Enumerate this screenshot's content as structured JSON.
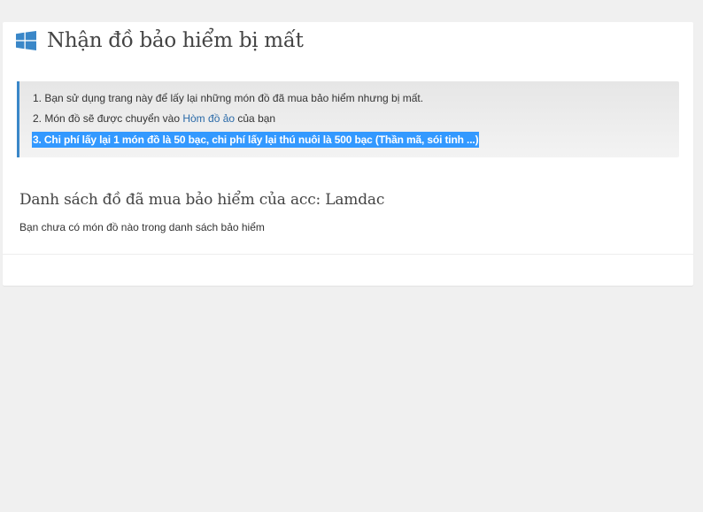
{
  "header": {
    "icon": "windows-logo-icon",
    "title": "Nhận đồ bảo hiểm bị mất"
  },
  "notice": {
    "line1": "1. Bạn sử dụng trang này để lấy lại những món đồ đã mua bảo hiểm nhưng bị mất.",
    "line2_prefix": "2. Món đồ sẽ được chuyển vào ",
    "line2_link": "Hòm đồ ảo",
    "line2_suffix": " của bạn",
    "line3": "3. Chi phí lấy lại 1 món đồ là 50 bạc, chi phí lấy lại thú nuôi là 500 bạc (Thần mã, sói tinh ...)"
  },
  "insured_list": {
    "title": "Danh sách đồ đã mua bảo hiểm của acc: Lamdac",
    "empty_message": "Bạn chưa có món đồ nào trong danh sách bảo hiểm"
  },
  "colors": {
    "accent": "#3a87c8",
    "link": "#2a6aa8",
    "selection": "#3399ff",
    "page_background": "#f0f0f0"
  }
}
